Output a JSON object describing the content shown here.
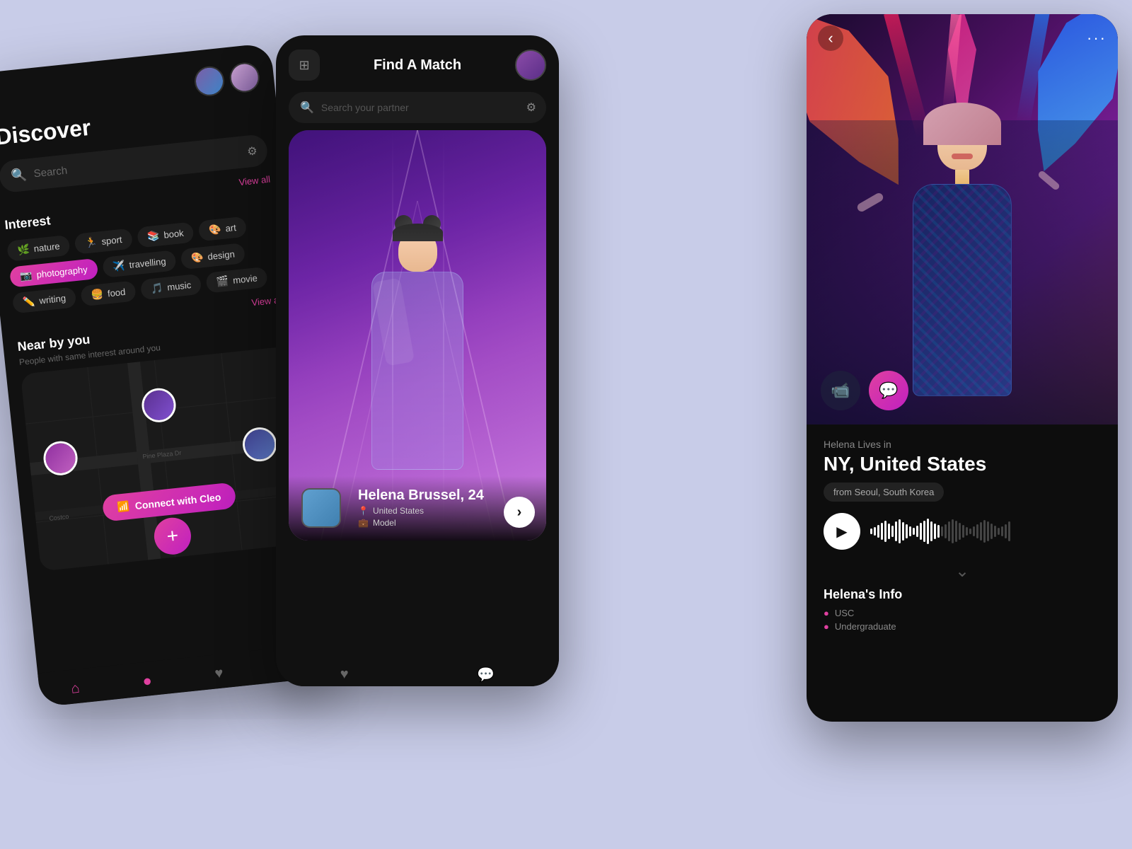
{
  "app": {
    "background": "#c8cce8"
  },
  "phone1": {
    "title": "Discover",
    "search": {
      "placeholder": "Search"
    },
    "viewAll1": "View all",
    "viewAll2": "View all",
    "interest": {
      "label": "Interest",
      "tags": [
        {
          "name": "nature",
          "emoji": "🌿",
          "active": false
        },
        {
          "name": "sport",
          "emoji": "🏃",
          "active": false
        },
        {
          "name": "book",
          "emoji": "📚",
          "active": false
        },
        {
          "name": "art",
          "emoji": "🎨",
          "active": false
        },
        {
          "name": "photography",
          "emoji": "📷",
          "active": true
        },
        {
          "name": "travelling",
          "emoji": "✈️",
          "active": false
        },
        {
          "name": "design",
          "emoji": "🎨",
          "active": false
        },
        {
          "name": "writing",
          "emoji": "✏️",
          "active": false
        },
        {
          "name": "food",
          "emoji": "🍔",
          "active": false
        },
        {
          "name": "music",
          "emoji": "🎵",
          "active": false
        },
        {
          "name": "movie",
          "emoji": "🎬",
          "active": false
        }
      ]
    },
    "nearby": {
      "title": "Near by you",
      "subtitle": "People with same interest around you",
      "mapLabel1": "Pine Plaza Dr",
      "mapLabel2": "Costco",
      "connectBtn": "Connect with Cleo"
    },
    "nav": {
      "home": "🏠",
      "compass": "🧭",
      "add": "+",
      "heart": "♥",
      "chat": "💬"
    }
  },
  "phone2": {
    "title": "Find A Match",
    "search": {
      "placeholder": "Search your partner"
    },
    "card": {
      "name": "Helena Brussel, 24",
      "location": "United States",
      "profession": "Model",
      "thumbGradient": "linear-gradient(135deg, #6020a0, #a040c0)"
    },
    "nav": {
      "heart": "♥",
      "chat": "💬"
    }
  },
  "phone3": {
    "livesInLabel": "Helena Lives in",
    "locationName": "NY, United States",
    "originBadge": "from Seoul, South Korea",
    "infoTitle": "Helena's Info",
    "infoItems": [
      {
        "label": "USC",
        "icon": "🎓"
      },
      {
        "label": "Undergraduate",
        "icon": "📋"
      }
    ],
    "audioPlayer": {
      "playIcon": "▶"
    }
  },
  "icons": {
    "search": "🔍",
    "filter": "⚙",
    "grid": "⊞",
    "back": "‹",
    "more": "···",
    "location": "📍",
    "suitcase": "💼",
    "video": "📹",
    "chat": "💬",
    "wifi": "📶",
    "home": "⌂",
    "play": "▶",
    "chevronDown": "⌄",
    "chevronRight": "›"
  }
}
